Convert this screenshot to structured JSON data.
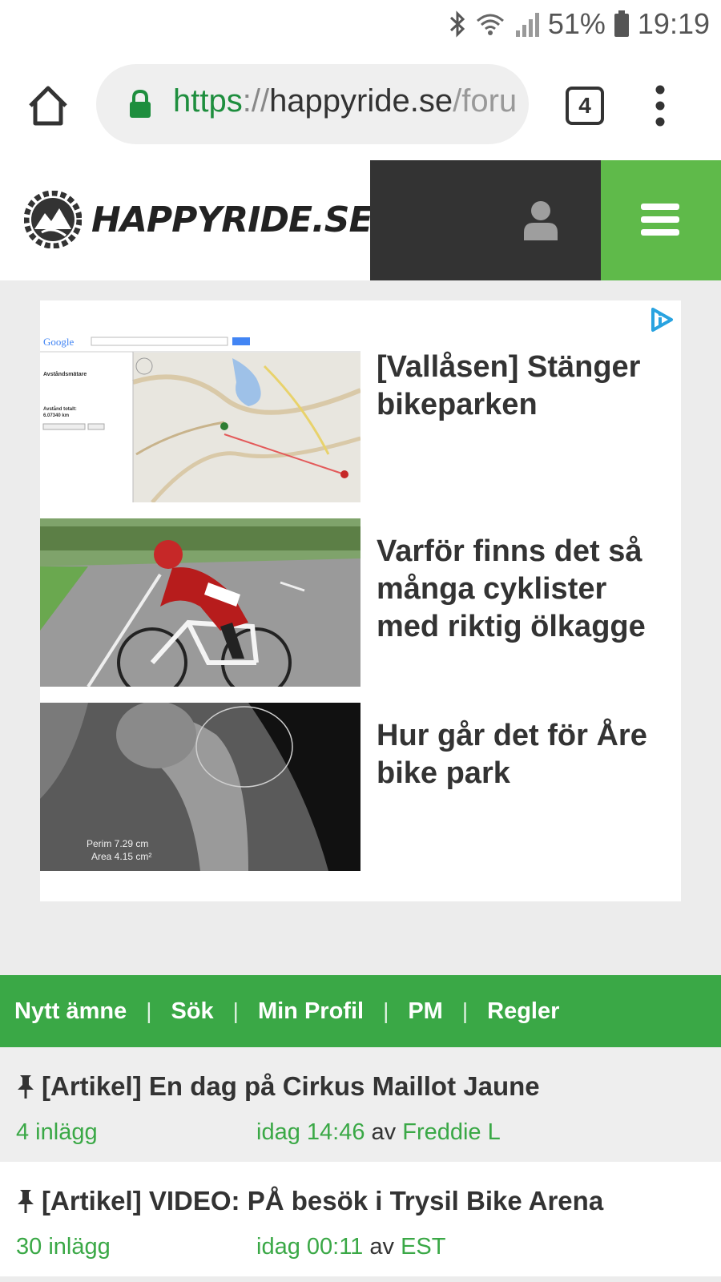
{
  "status": {
    "battery": "51%",
    "time": "19:19"
  },
  "browser": {
    "url_scheme": "https",
    "url_sep": "://",
    "url_host": "happyride.se",
    "url_path": "/forum",
    "tab_count": "4"
  },
  "site": {
    "logo": "HAPPYRIDE.SE"
  },
  "ads": [
    {
      "title": "[Vallåsen] Stänger bikeparken"
    },
    {
      "title": "Varför finns det så många cyklister med riktig ölkagge"
    },
    {
      "title": "Hur går det för Åre bike park"
    }
  ],
  "ad_map": {
    "search_brand": "Google",
    "sidebar_title": "Avståndsmätare",
    "distance_label": "Avstånd totalt:",
    "distance_value": "6.07340 km"
  },
  "ad_xray": {
    "line1": "Perim 7.29 cm",
    "line2": "Area 4.15 cm²"
  },
  "forum_nav": [
    "Nytt ämne",
    "Sök",
    "Min Profil",
    "PM",
    "Regler"
  ],
  "topics": [
    {
      "title": "[Artikel] En dag på Cirkus Maillot Jaune",
      "count": "4 inlägg",
      "time": "idag 14:46",
      "by": "av",
      "author": "Freddie L"
    },
    {
      "title": "[Artikel] VIDEO: PÅ besök i Trysil Bike Arena",
      "count": "30 inlägg",
      "time": "idag 00:11",
      "by": "av",
      "author": "EST"
    }
  ],
  "colors": {
    "brand_green": "#5fba4a",
    "nav_green": "#3aa846",
    "header_dark": "#333333"
  }
}
